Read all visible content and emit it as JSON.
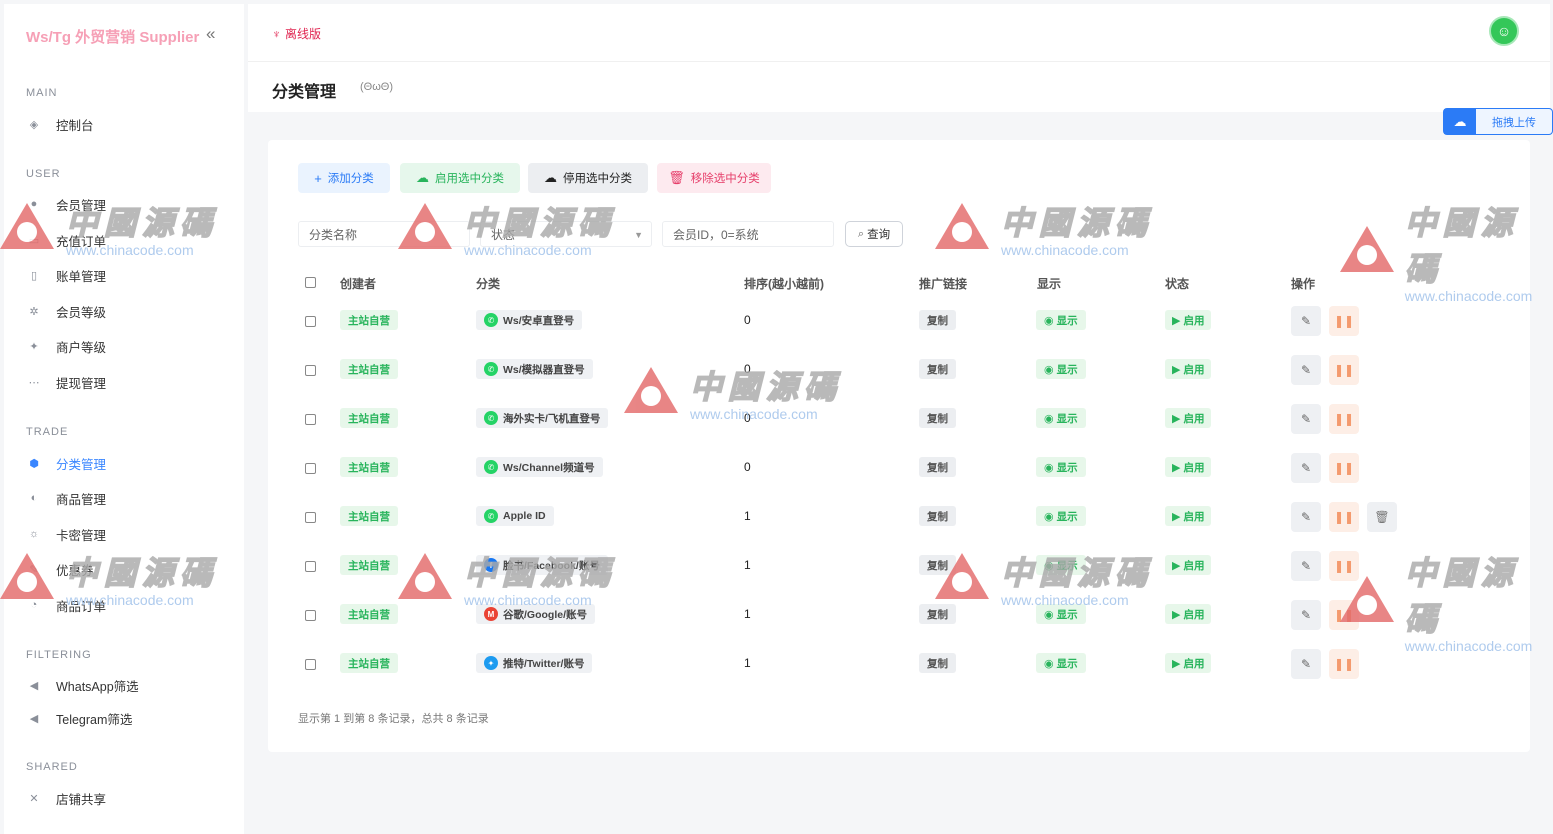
{
  "brand": {
    "title": "Ws/Tg 外贸营销 Supplier",
    "collapse_icon": "double-chevron-left-icon"
  },
  "sidebar": {
    "sections": [
      {
        "label": "MAIN",
        "items": [
          {
            "label": "控制台",
            "icon": "dashboard-icon"
          }
        ]
      },
      {
        "label": "USER",
        "items": [
          {
            "label": "会员管理",
            "icon": "user-icon"
          },
          {
            "label": "充值订单",
            "icon": "wallet-icon"
          },
          {
            "label": "账单管理",
            "icon": "bill-icon"
          },
          {
            "label": "会员等级",
            "icon": "level-icon"
          },
          {
            "label": "商户等级",
            "icon": "star-icon"
          },
          {
            "label": "提现管理",
            "icon": "withdraw-icon"
          }
        ]
      },
      {
        "label": "TRADE",
        "items": [
          {
            "label": "分类管理",
            "icon": "category-icon",
            "active": true
          },
          {
            "label": "商品管理",
            "icon": "goods-icon"
          },
          {
            "label": "卡密管理",
            "icon": "card-key-icon"
          },
          {
            "label": "优惠券",
            "icon": "coupon-icon"
          },
          {
            "label": "商品订单",
            "icon": "order-icon"
          }
        ]
      },
      {
        "label": "FILTERING",
        "items": [
          {
            "label": "WhatsApp筛选",
            "icon": "send-icon"
          },
          {
            "label": "Telegram筛选",
            "icon": "send-icon"
          }
        ]
      },
      {
        "label": "SHARED",
        "items": [
          {
            "label": "店铺共享",
            "icon": "share-icon"
          }
        ]
      }
    ]
  },
  "header": {
    "offline_label": "离线版",
    "page_title": "分类管理",
    "page_sub": "(ΘωΘ)",
    "upload_label": "拖拽上传"
  },
  "toolbar": {
    "add_label": "添加分类",
    "enable_label": "启用选中分类",
    "disable_label": "停用选中分类",
    "remove_label": "移除选中分类"
  },
  "filters": {
    "name_placeholder": "分类名称",
    "status_placeholder": "状态",
    "member_placeholder": "会员ID，0=系统",
    "search_label": "查询"
  },
  "table": {
    "headers": {
      "creator": "创建者",
      "category": "分类",
      "sort": "排序(越小越前)",
      "link": "推广链接",
      "show": "显示",
      "status": "状态",
      "ops": "操作"
    },
    "rows": [
      {
        "creator": "主站自营",
        "category": "Ws/安卓直登号",
        "icon": "whatsapp-icon",
        "icon_color": "#25d366",
        "sort": "0",
        "link": "复制",
        "show": "显示",
        "status": "启用",
        "deletable": false
      },
      {
        "creator": "主站自营",
        "category": "Ws/模拟器直登号",
        "icon": "whatsapp-icon",
        "icon_color": "#25d366",
        "sort": "0",
        "link": "复制",
        "show": "显示",
        "status": "启用",
        "deletable": false
      },
      {
        "creator": "主站自营",
        "category": "海外实卡/飞机直登号",
        "icon": "whatsapp-icon",
        "icon_color": "#25d366",
        "sort": "0",
        "link": "复制",
        "show": "显示",
        "status": "启用",
        "deletable": false
      },
      {
        "creator": "主站自营",
        "category": "Ws/Channel频道号",
        "icon": "whatsapp-icon",
        "icon_color": "#25d366",
        "sort": "0",
        "link": "复制",
        "show": "显示",
        "status": "启用",
        "deletable": false
      },
      {
        "creator": "主站自营",
        "category": "Apple ID",
        "icon": "whatsapp-icon",
        "icon_color": "#25d366",
        "sort": "1",
        "link": "复制",
        "show": "显示",
        "status": "启用",
        "deletable": true
      },
      {
        "creator": "主站自营",
        "category": "脸书/Facebook/账号",
        "icon": "facebook-icon",
        "icon_color": "#1877f2",
        "sort": "1",
        "link": "复制",
        "show": "显示",
        "status": "启用",
        "deletable": false
      },
      {
        "creator": "主站自营",
        "category": "谷歌/Google/账号",
        "icon": "gmail-icon",
        "icon_color": "#ea4335",
        "sort": "1",
        "link": "复制",
        "show": "显示",
        "status": "启用",
        "deletable": false
      },
      {
        "creator": "主站自营",
        "category": "推特/Twitter/账号",
        "icon": "twitter-icon",
        "icon_color": "#1d9bf0",
        "sort": "1",
        "link": "复制",
        "show": "显示",
        "status": "启用",
        "deletable": false
      }
    ]
  },
  "pagination": {
    "info": "显示第 1 到第 8 条记录，总共 8 条记录"
  },
  "watermark": {
    "big": "中國源碼",
    "small": "www.chinacode.com"
  },
  "colors": {
    "accent": "#2b7bf6",
    "success": "#28b45c",
    "danger": "#e63e6a",
    "brand": "#f6a0b6"
  }
}
